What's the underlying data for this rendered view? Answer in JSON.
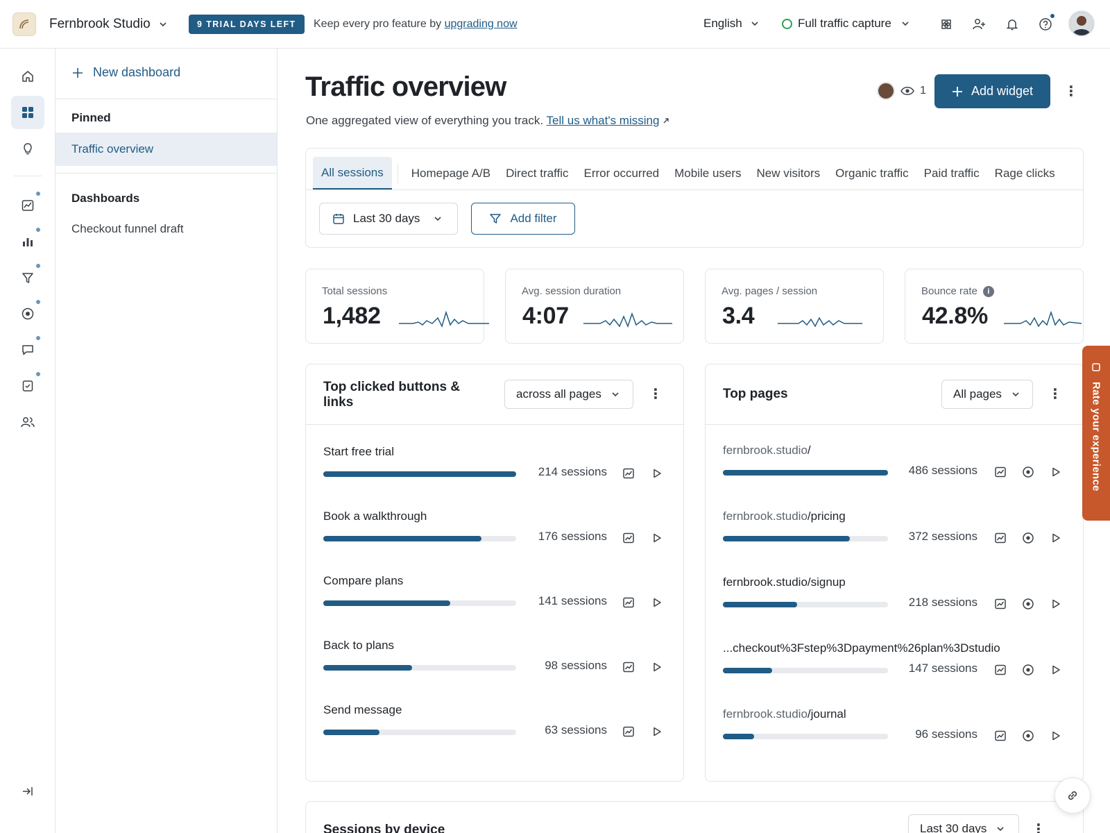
{
  "topbar": {
    "workspace": "Fernbrook Studio",
    "trial_badge": "9 TRIAL DAYS LEFT",
    "trial_message": "Keep every pro feature by",
    "trial_link": "upgrading now",
    "language": "English",
    "capture_mode": "Full traffic capture",
    "icons": [
      "puzzle-icon",
      "add-user-icon",
      "bell-icon",
      "help-icon"
    ]
  },
  "rail": {
    "items": [
      "home-icon",
      "dashboards-icon",
      "lightbulb-icon",
      "trends-icon",
      "bar-chart-icon",
      "funnel-icon",
      "target-icon",
      "chat-icon",
      "survey-icon",
      "users-icon"
    ],
    "collapse": "collapse-icon"
  },
  "sidebar": {
    "new_dashboard": "New dashboard",
    "pinned_heading": "Pinned",
    "pinned_items": [
      "Traffic overview"
    ],
    "dashboards_heading": "Dashboards",
    "dashboard_items": [
      "Checkout funnel draft"
    ]
  },
  "page": {
    "title": "Traffic overview",
    "subtitle": "One aggregated view of everything you track.",
    "subtitle_link": "Tell us what's missing",
    "viewer_count": "1",
    "add_widget": "Add widget"
  },
  "filters": {
    "tabs": [
      "All sessions",
      "Homepage A/B",
      "Direct traffic",
      "Error occurred",
      "Mobile users",
      "New visitors",
      "Organic traffic",
      "Paid traffic",
      "Rage clicks"
    ],
    "active_tab": 0,
    "date_range": "Last 30 days",
    "add_filter": "Add filter"
  },
  "stats": [
    {
      "label": "Total sessions",
      "value": "1,482"
    },
    {
      "label": "Avg. session duration",
      "value": "4:07"
    },
    {
      "label": "Avg. pages / session",
      "value": "3.4"
    },
    {
      "label": "Bounce rate",
      "value": "42.8%"
    }
  ],
  "clicked_panel": {
    "title_line1": "Top clicked buttons &",
    "title_line2": "links",
    "scope": "across all pages",
    "rows": [
      {
        "label": "Start free trial",
        "count": "214 sessions",
        "fraction": 1.0
      },
      {
        "label": "Book a walkthrough",
        "count": "176 sessions",
        "fraction": 0.82
      },
      {
        "label": "Compare plans",
        "count": "141 sessions",
        "fraction": 0.66
      },
      {
        "label": "Back to plans",
        "count": "98 sessions",
        "fraction": 0.46
      },
      {
        "label": "Send message",
        "count": "63 sessions",
        "fraction": 0.29
      }
    ]
  },
  "pages_panel": {
    "title": "Top pages",
    "scope": "All pages",
    "rows": [
      {
        "domain": "fernbrook.studio",
        "path": "/",
        "count": "486 sessions",
        "fraction": 1.0
      },
      {
        "domain": "fernbrook.studio",
        "path": "/pricing",
        "count": "372 sessions",
        "fraction": 0.77
      },
      {
        "domain": "",
        "path": "fernbrook.studio/signup",
        "count": "218 sessions",
        "fraction": 0.45
      },
      {
        "domain": "",
        "path": "...checkout%3Fstep%3Dpayment%26plan%3Dstudio",
        "count": "147 sessions",
        "fraction": 0.3
      },
      {
        "domain": "fernbrook.studio",
        "path": "/journal",
        "count": "96 sessions",
        "fraction": 0.19
      }
    ]
  },
  "device_panel": {
    "title": "Sessions by device",
    "range": "Last 30 days"
  },
  "feedback_tab": "Rate your experience",
  "colors": {
    "accent": "#215c85",
    "feedback": "#c7582c",
    "online": "#2f9e58"
  }
}
